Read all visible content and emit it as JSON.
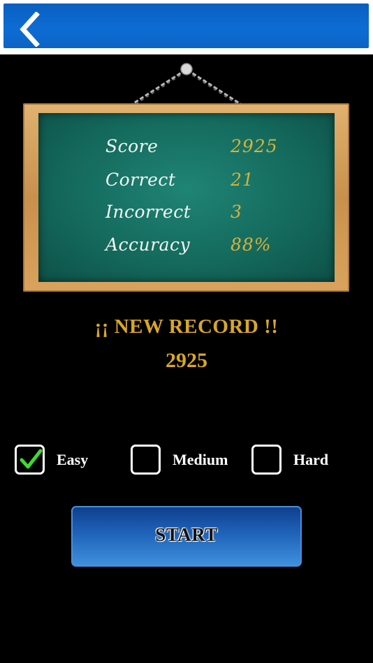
{
  "header": {
    "back_icon": "chevron-left-icon"
  },
  "board": {
    "stats": [
      {
        "label": "Score",
        "value": "2925"
      },
      {
        "label": "Correct",
        "value": "21"
      },
      {
        "label": "Incorrect",
        "value": "3"
      },
      {
        "label": "Accuracy",
        "value": "88%"
      }
    ]
  },
  "record": {
    "title": "¡¡ NEW RECORD !!",
    "value": "2925"
  },
  "difficulty": {
    "options": [
      {
        "label": "Easy",
        "checked": true
      },
      {
        "label": "Medium",
        "checked": false
      },
      {
        "label": "Hard",
        "checked": false
      }
    ]
  },
  "start": {
    "label": "START"
  },
  "colors": {
    "header_blue": "#0d6cd3",
    "chalkboard": "#146a5d",
    "chalk_value": "#d8b23a",
    "record_gold": "#d9a727",
    "check_green": "#3ddc2c"
  }
}
